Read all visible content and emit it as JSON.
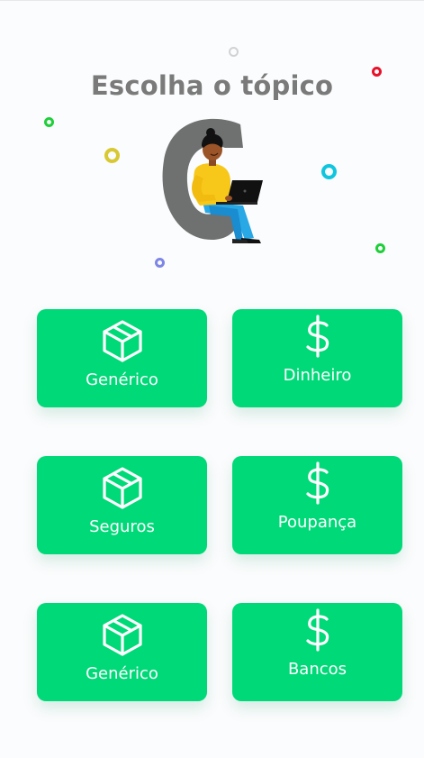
{
  "header": {
    "title": "Escolha o tópico"
  },
  "colors": {
    "card_background": "#00d978",
    "title_text": "#7a7a7a",
    "card_text": "#ffffff",
    "page_background": "#fbfcfd"
  },
  "topics": [
    {
      "label": "Genérico",
      "icon": "box-icon"
    },
    {
      "label": "Dinheiro",
      "icon": "dollar-icon"
    },
    {
      "label": "Seguros",
      "icon": "box-icon"
    },
    {
      "label": "Poupança",
      "icon": "dollar-icon"
    },
    {
      "label": "Genérico",
      "icon": "box-icon"
    },
    {
      "label": "Bancos",
      "icon": "dollar-icon"
    }
  ]
}
